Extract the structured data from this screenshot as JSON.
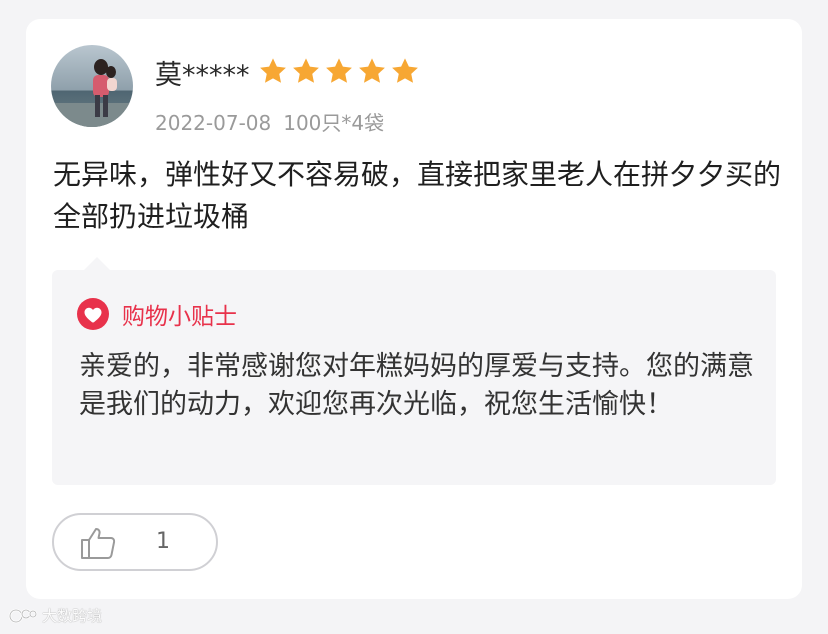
{
  "review": {
    "username": "莫*****",
    "rating": 5,
    "rating_max": 5,
    "date": "2022-07-08",
    "spec": "100只*4袋",
    "text": "无异味，弹性好又不容易破，直接把家里老人在拼夕夕买的全部扔进垃圾桶"
  },
  "tip": {
    "title": "购物小贴士",
    "body": "亲爱的，非常感谢您对年糕妈妈的厚爱与支持。您的满意是我们的动力，欢迎您再次光临，祝您生活愉快！"
  },
  "like": {
    "count": "1"
  },
  "watermark": {
    "text": "大数跨境"
  },
  "icons": {
    "avatar": "avatar-photo",
    "star": "star-icon",
    "tip": "heart-icon",
    "like": "thumbs-up-icon",
    "watermark": "brand-logo"
  },
  "colors": {
    "star": "#f7a733",
    "tip_accent": "#e8324b",
    "background": "#f4f4f6",
    "card": "#ffffff",
    "tip_box": "#f5f5f7"
  }
}
